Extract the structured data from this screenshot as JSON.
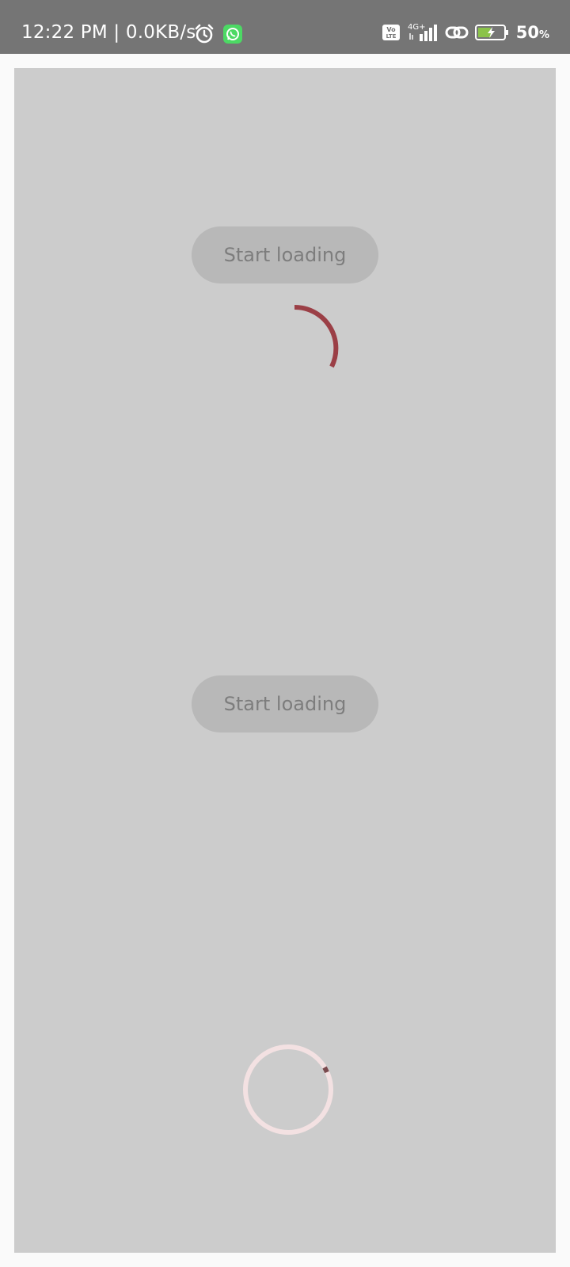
{
  "status_bar": {
    "time_speed": "12:22 PM | 0.0KB/s",
    "network_type": "4G+",
    "volte_label": "Vo LTE",
    "battery_percent": "50",
    "battery_unit": "%",
    "icons": [
      "alarm-icon",
      "whatsapp-icon",
      "volte-icon",
      "signal-icon",
      "link-icon",
      "battery-charging-icon"
    ],
    "colors": {
      "bar_bg": "#757575",
      "whatsapp": "#4cd964",
      "battery_fill": "#8bc34a"
    }
  },
  "main": {
    "background": "#cccccc",
    "buttons": [
      {
        "label": "Start loading"
      },
      {
        "label": "Start loading"
      }
    ],
    "spinners": [
      {
        "type": "indeterminate-arc",
        "color": "#9b3f46"
      },
      {
        "type": "determinate-ring",
        "track_color": "#f3e1e2",
        "indicator_color": "#7a4a4e",
        "progress": 0.02
      }
    ]
  }
}
